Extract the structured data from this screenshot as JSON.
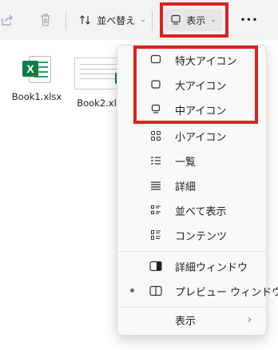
{
  "toolbar": {
    "sort_label": "並べ替え",
    "view_label": "表示",
    "more_label": "•••"
  },
  "files": [
    {
      "name": "Book1.xlsx"
    },
    {
      "name": "Book2.xls"
    }
  ],
  "menu": {
    "items": [
      {
        "label": "特大アイコン",
        "icon": "monitor-icon"
      },
      {
        "label": "大アイコン",
        "icon": "monitor-icon"
      },
      {
        "label": "中アイコン",
        "icon": "monitor-icon"
      },
      {
        "label": "小アイコン",
        "icon": "small-icons-grid-icon"
      },
      {
        "label": "一覧",
        "icon": "list-icon"
      },
      {
        "label": "詳細",
        "icon": "details-icon"
      },
      {
        "label": "並べて表示",
        "icon": "tiles-icon"
      },
      {
        "label": "コンテンツ",
        "icon": "content-icon"
      },
      {
        "label": "詳細ウィンドウ",
        "icon": "details-pane-icon"
      },
      {
        "label": "プレビュー ウィンドウ",
        "icon": "preview-pane-icon",
        "selected": true
      },
      {
        "label": "表示",
        "icon": "",
        "submenu": true
      }
    ]
  },
  "highlight_color": "#e02020",
  "excel_green": "#107c41"
}
